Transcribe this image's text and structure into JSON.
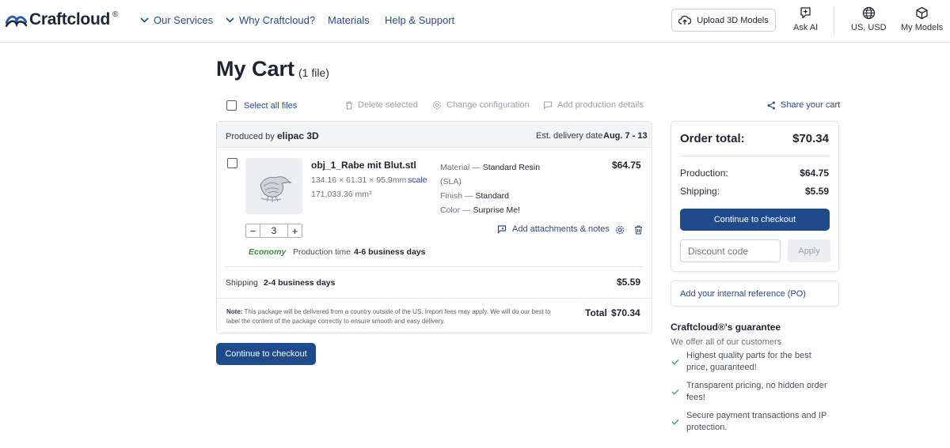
{
  "header": {
    "logo_text": "Craftcloud",
    "logo_reg": "®",
    "nav": {
      "our_services": "Our Services",
      "why_craftcloud": "Why Craftcloud?",
      "materials": "Materials",
      "help_support": "Help & Support"
    },
    "upload_label": "Upload 3D Models",
    "ask_ai_label": "Ask AI",
    "region_label": "US, USD",
    "my_models_label": "My Models"
  },
  "page": {
    "title": "My Cart",
    "file_count": "(1 file)"
  },
  "toolbar": {
    "select_all": "Select all files",
    "delete_selected": "Delete selected",
    "change_configuration": "Change configuration",
    "add_production_details": "Add production details",
    "share_cart": "Share your cart"
  },
  "cart": {
    "produced_by_label": "Produced by",
    "producer": "elipac 3D",
    "delivery_label": "Est. delivery date",
    "delivery_date": "Aug. 7 - 13",
    "item": {
      "filename": "obj_1_Rabe mit Blut.stl",
      "dimensions": "134.16 × 61.31 × 95.9mm",
      "scale_link": "scale",
      "volume": "171,033.36 mm³",
      "material_label": "Material —",
      "material_value": "Standard Resin",
      "material_sub": "(SLA)",
      "finish_label": "Finish —",
      "finish_value": "Standard",
      "color_label": "Color —",
      "color_value": "Surprise Me!",
      "price": "$64.75",
      "quantity": "3",
      "add_attachments": "Add attachments & notes",
      "tier": "Economy",
      "production_time_label": "Production time",
      "production_time_value": "4-6 business days"
    },
    "shipping_label": "Shipping",
    "shipping_time": "2-4 business days",
    "shipping_price": "$5.59",
    "note_label": "Note:",
    "note_text": "This package will be delivered from a country outside of the US. Import fees may apply. We will do our best to label the content of the package correctly to ensure smooth and easy delivery.",
    "total_label": "Total",
    "total_value": "$70.34"
  },
  "checkout_button": "Continue to checkout",
  "summary": {
    "order_total_label": "Order total:",
    "order_total_value": "$70.34",
    "production_label": "Production:",
    "production_value": "$64.75",
    "shipping_label": "Shipping:",
    "shipping_value": "$5.59",
    "checkout_button": "Continue to checkout",
    "discount_placeholder": "Discount code",
    "apply_label": "Apply",
    "po_label": "Add your internal reference (PO)"
  },
  "guarantee": {
    "title": "Craftcloud®'s guarantee",
    "subtitle": "We offer all of our customers",
    "items": [
      "Highest quality parts for the best price, guaranteed!",
      "Transparent pricing, no hidden order fees!",
      "Secure payment transactions and IP protection."
    ]
  },
  "colors": {
    "brand_blue": "#1f4a8c",
    "link_blue": "#2b4a86",
    "economy_green": "#3b8a3b",
    "check_green": "#3ea06a"
  }
}
